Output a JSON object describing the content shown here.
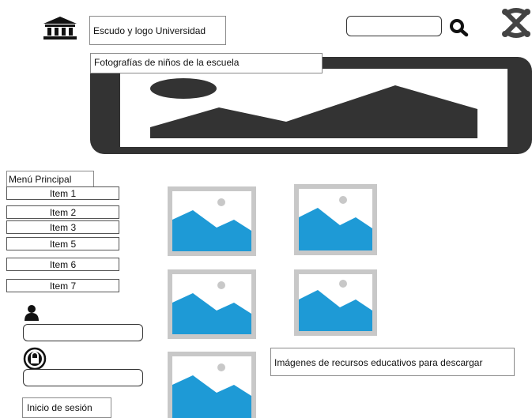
{
  "header": {
    "logo_label": "Escudo y logo Universidad",
    "search": {
      "value": "",
      "placeholder": ""
    }
  },
  "banner": {
    "caption": "Fotografías de niños de la escuela"
  },
  "menu": {
    "title": "Menú Principal",
    "items": [
      {
        "label": "Item 1"
      },
      {
        "label": "Item 2"
      },
      {
        "label": "Item 3"
      },
      {
        "label": "Item 5"
      },
      {
        "label": "Item 6"
      },
      {
        "label": "Item 7"
      }
    ]
  },
  "login": {
    "username": {
      "value": "",
      "placeholder": ""
    },
    "password": {
      "value": "",
      "placeholder": ""
    },
    "submit_label": "Inicio de sesión"
  },
  "resources": {
    "caption": "Imágenes de recursos educativos para descargar"
  },
  "icons": {
    "university": "university-icon",
    "search": "search-icon",
    "brand": "joomla-icon",
    "user": "user-icon",
    "lock": "lock-icon",
    "image": "image-placeholder-icon"
  },
  "colors": {
    "image_blue": "#1e9ad6",
    "frame_gray": "#c8c8c8",
    "banner_dark": "#333333"
  }
}
